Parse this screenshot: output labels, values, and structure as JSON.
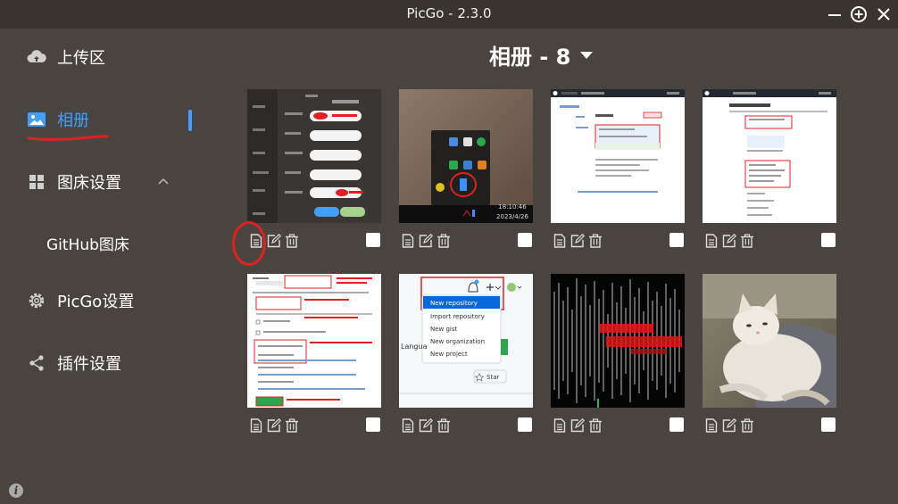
{
  "app": {
    "title": "PicGo - 2.3.0"
  },
  "window_controls": {
    "minimize": "minimize-icon",
    "maximize": "plus-circle-icon",
    "close": "close-icon"
  },
  "sidebar": {
    "items": [
      {
        "label": "上传区",
        "icon": "cloud-upload-icon"
      },
      {
        "label": "相册",
        "icon": "image-icon",
        "active": true
      },
      {
        "label": "图床设置",
        "icon": "grid-icon",
        "expanded": true
      },
      {
        "label": "GitHub图床",
        "icon": ""
      },
      {
        "label": "PicGo设置",
        "icon": "gear-icon"
      },
      {
        "label": "插件设置",
        "icon": "share-icon"
      }
    ]
  },
  "album": {
    "title": "相册 - 8",
    "dropdown_icon": "caret-down-icon"
  },
  "gallery": {
    "images": [
      {
        "alt": "settings-screenshot"
      },
      {
        "alt": "taskbar-screenshot",
        "time": "18:10:46",
        "date": "2023/4/26"
      },
      {
        "alt": "github-page-screenshot"
      },
      {
        "alt": "github-settings-screenshot"
      },
      {
        "alt": "github-create-repo-screenshot"
      },
      {
        "alt": "github-new-menu-screenshot",
        "menu": [
          "New repository",
          "Import repository",
          "New gist",
          "New organization",
          "New project"
        ],
        "star_label": "Star",
        "partial_text": "Langua"
      },
      {
        "alt": "waveform-image"
      },
      {
        "alt": "cat-photo"
      }
    ]
  },
  "colors": {
    "accent": "#409eff",
    "background": "#4a4440",
    "annotation": "#e02020"
  }
}
